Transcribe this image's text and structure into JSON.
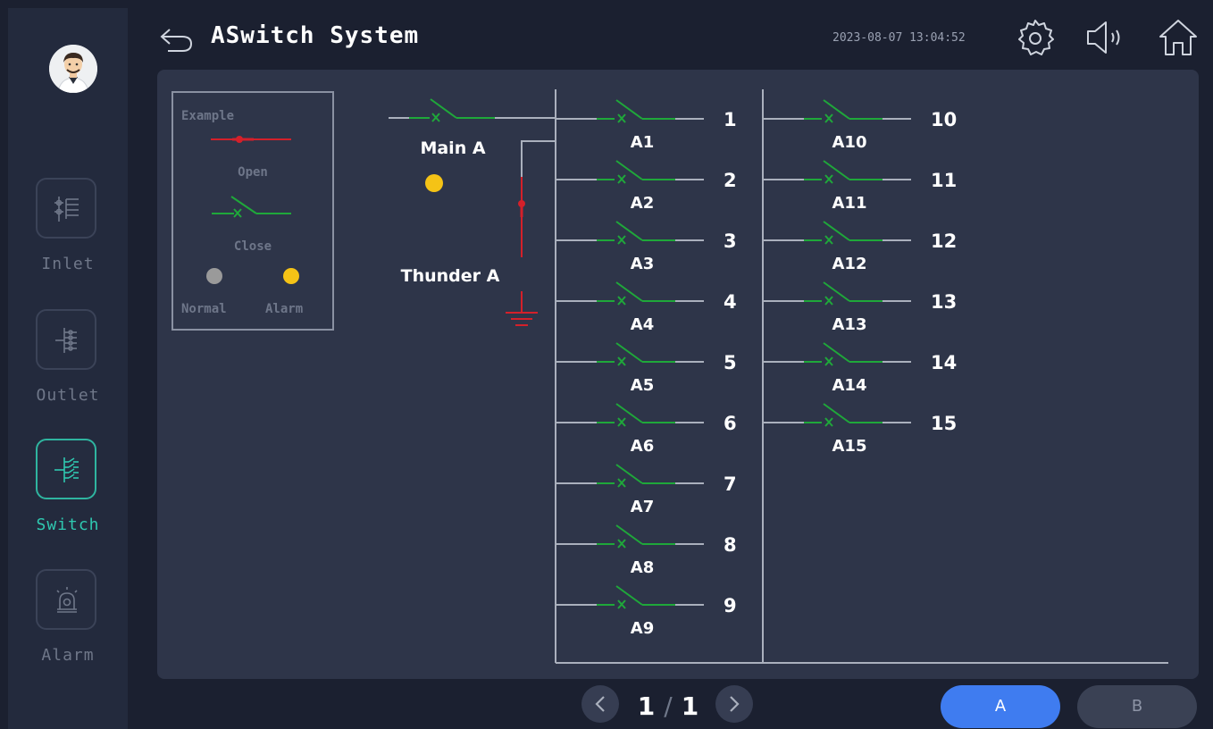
{
  "header": {
    "title": "ASwitch System",
    "datetime": "2023-08-07 13:04:52",
    "icons": [
      "back-arrow-icon",
      "gear-icon",
      "speaker-icon",
      "home-icon"
    ]
  },
  "sidebar": {
    "items": [
      {
        "label": "Inlet",
        "icon": "inlet-icon",
        "active": false
      },
      {
        "label": "Outlet",
        "icon": "outlet-icon",
        "active": false
      },
      {
        "label": "Switch",
        "icon": "switch-icon",
        "active": true
      },
      {
        "label": "Alarm",
        "icon": "alarm-icon",
        "active": false
      }
    ]
  },
  "legend": {
    "title": "Example",
    "open_label": "Open",
    "close_label": "Close",
    "normal_label": "Normal",
    "alarm_label": "Alarm"
  },
  "diagram": {
    "main_label": "Main A",
    "thunder_label": "Thunder A",
    "main_status": "alarm",
    "column1": [
      {
        "number": "1",
        "name": "A1",
        "state": "closed"
      },
      {
        "number": "2",
        "name": "A2",
        "state": "closed"
      },
      {
        "number": "3",
        "name": "A3",
        "state": "closed"
      },
      {
        "number": "4",
        "name": "A4",
        "state": "closed"
      },
      {
        "number": "5",
        "name": "A5",
        "state": "closed"
      },
      {
        "number": "6",
        "name": "A6",
        "state": "closed"
      },
      {
        "number": "7",
        "name": "A7",
        "state": "closed"
      },
      {
        "number": "8",
        "name": "A8",
        "state": "closed"
      },
      {
        "number": "9",
        "name": "A9",
        "state": "closed"
      }
    ],
    "column2": [
      {
        "number": "10",
        "name": "A10",
        "state": "closed"
      },
      {
        "number": "11",
        "name": "A11",
        "state": "closed"
      },
      {
        "number": "12",
        "name": "A12",
        "state": "closed"
      },
      {
        "number": "13",
        "name": "A13",
        "state": "closed"
      },
      {
        "number": "14",
        "name": "A14",
        "state": "closed"
      },
      {
        "number": "15",
        "name": "A15",
        "state": "closed"
      }
    ]
  },
  "pager": {
    "current": "1",
    "separator": "/",
    "total": "1"
  },
  "tabs": [
    {
      "label": "A",
      "active": true
    },
    {
      "label": "B",
      "active": false
    }
  ],
  "colors": {
    "closed": "#1fa83a",
    "open": "#d4202a",
    "alarm": "#f5c316",
    "normal": "#9a9a9a",
    "active_accent": "#2fc8b0",
    "tab_active": "#3f7cf0"
  }
}
